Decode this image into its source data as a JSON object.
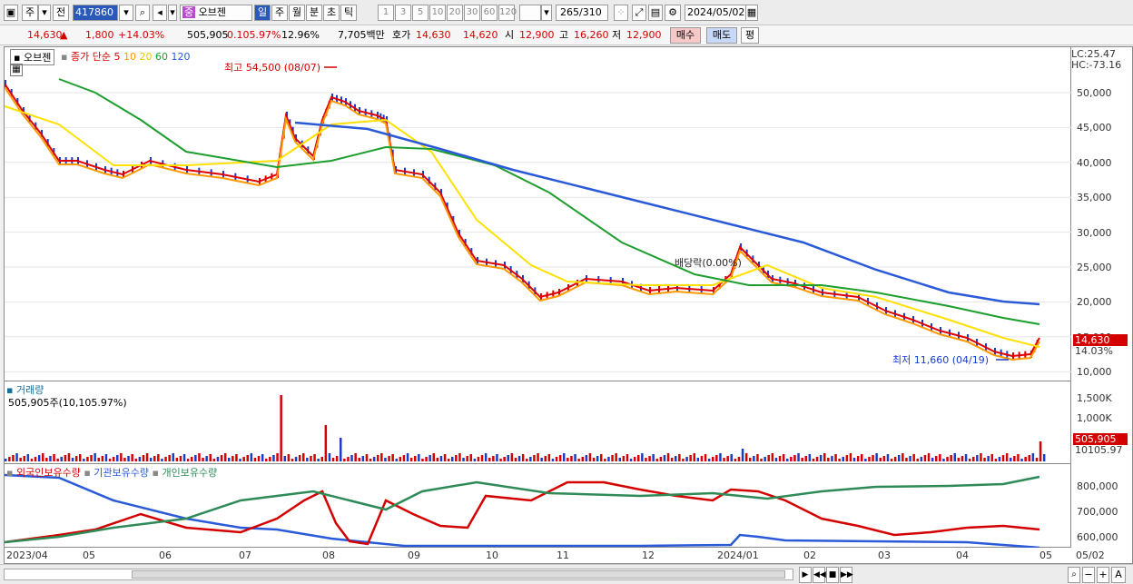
{
  "toolbar": {
    "market": "주",
    "prev": "전",
    "code": "417860",
    "name": "오브젠",
    "periods": [
      "일",
      "주",
      "월",
      "분",
      "초",
      "틱"
    ],
    "ranges": [
      "1",
      "3",
      "5",
      "10",
      "20",
      "30",
      "60",
      "120"
    ],
    "count": "265",
    "total": "/310",
    "date": "2024/05/02"
  },
  "quote": {
    "price": "14,630",
    "change": "1,800",
    "pct": "+14.03%",
    "volume": "505,905",
    "vol_ratio": "0.105.97%",
    "turnover": "12.96%",
    "amount": "7,705백만",
    "bid_label": "호가",
    "ask": "14,630",
    "bid": "14,620",
    "open_label": "시",
    "open": "12,900",
    "high_label": "고",
    "high": "16,260",
    "low_label": "저",
    "low": "12,900",
    "buy": "매수",
    "sell": "매도",
    "eval": "평"
  },
  "price_legend": {
    "name": "오브젠",
    "ma_label": "종가 단순",
    "mas": [
      "5",
      "10",
      "20",
      "60",
      "120"
    ]
  },
  "annotations": {
    "high": "최고 54,500 (08/07)",
    "low": "최저 11,660 (04/19)",
    "dividend": "배당락(0.00%)"
  },
  "lc": "LC:25.47",
  "hc": "HC:-73.16",
  "price_tag": "14,630",
  "pct_tag": "14.03%",
  "price_axis": [
    "50,000",
    "45,000",
    "40,000",
    "35,000",
    "30,000",
    "25,000",
    "20,000",
    "15,000",
    "10,000"
  ],
  "volume": {
    "title": "거래량",
    "value": "505,905주(10,105.97%)",
    "axis": [
      "1,500K",
      "1,000K"
    ],
    "tag": "505,905",
    "tag2": "10105.97"
  },
  "owner": {
    "legend": [
      "외국인보유수량",
      "기관보유수량",
      "개인보유수량"
    ],
    "axis": [
      "800,000",
      "700,000",
      "600,000"
    ]
  },
  "x_axis": [
    "2023/04",
    "05",
    "06",
    "07",
    "08",
    "09",
    "10",
    "11",
    "12",
    "2024/01",
    "02",
    "03",
    "04",
    "05",
    "05/02"
  ],
  "colors": {
    "up": "#d40000",
    "down": "#1a3cc8",
    "ma5": "#e00000",
    "ma10": "#ff9900",
    "ma20": "#ffe000",
    "ma60": "#1e9e2e",
    "ma120": "#2a5ad8",
    "foreign": "#d40000",
    "inst": "#2a5ad8",
    "indiv": "#2e8b57"
  }
}
